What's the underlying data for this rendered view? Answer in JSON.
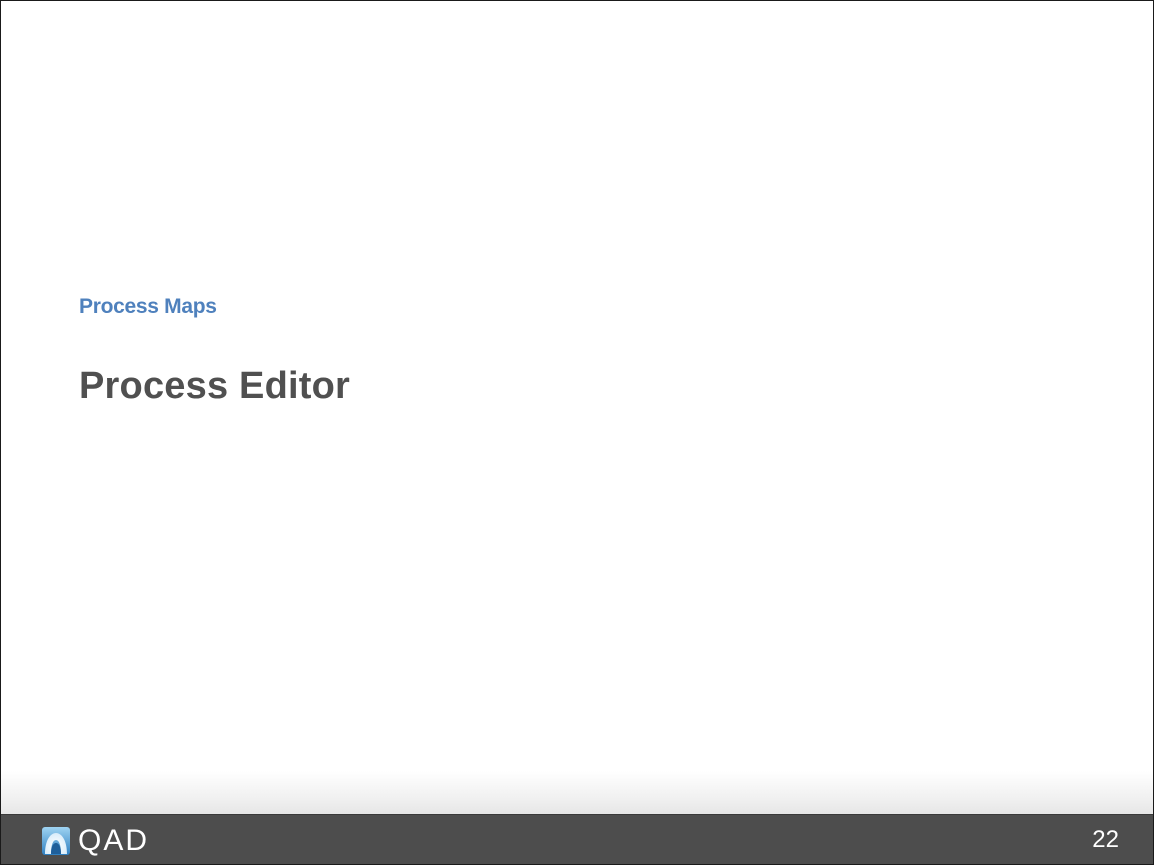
{
  "slide": {
    "section_label": "Process Maps",
    "title": "Process Editor"
  },
  "footer": {
    "logo_text": "QAD",
    "logo_icon": "qad-logo-icon",
    "page_number": "22"
  },
  "colors": {
    "section_label": "#4f81bd",
    "title": "#505050",
    "footer_bg": "#4d4d4d",
    "footer_text": "#ffffff"
  }
}
